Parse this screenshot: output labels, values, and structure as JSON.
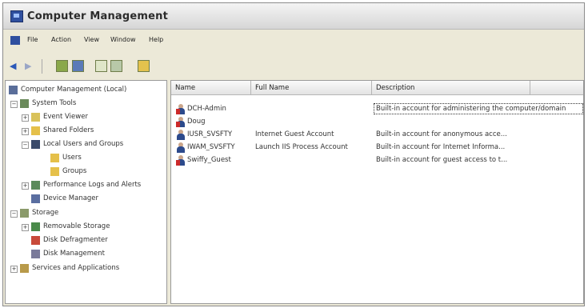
{
  "window": {
    "title": "Computer Management"
  },
  "menubar": {
    "items": [
      "File",
      "Action",
      "View",
      "Window",
      "Help"
    ]
  },
  "tree": {
    "root": "Computer Management (Local)",
    "system_tools": "System Tools",
    "event_viewer": "Event Viewer",
    "shared_folders": "Shared Folders",
    "local_users_groups": "Local Users and Groups",
    "users": "Users",
    "groups": "Groups",
    "perf_logs": "Performance Logs and Alerts",
    "device_manager": "Device Manager",
    "storage": "Storage",
    "removable_storage": "Removable Storage",
    "defrag": "Disk Defragmenter",
    "disk_management": "Disk Management",
    "services_apps": "Services and Applications"
  },
  "list": {
    "columns": [
      "Name",
      "Full Name",
      "Description"
    ],
    "rows": [
      {
        "name": "DCH-Admin",
        "full_name": "",
        "description": "Built-in account for administering the computer/domain"
      },
      {
        "name": "Doug",
        "full_name": "",
        "description": ""
      },
      {
        "name": "IUSR_SVSFTY",
        "full_name": "Internet Guest Account",
        "description": "Built-in account for anonymous acce..."
      },
      {
        "name": "IWAM_SVSFTY",
        "full_name": "Launch IIS Process Account",
        "description": "Built-in account for Internet Informa..."
      },
      {
        "name": "Swiffy_Guest",
        "full_name": "",
        "description": "Built-in account for guest access to t..."
      }
    ]
  },
  "colors": {
    "user_icon_mark": "#cc2a2a",
    "folder": "#e5c04a"
  }
}
